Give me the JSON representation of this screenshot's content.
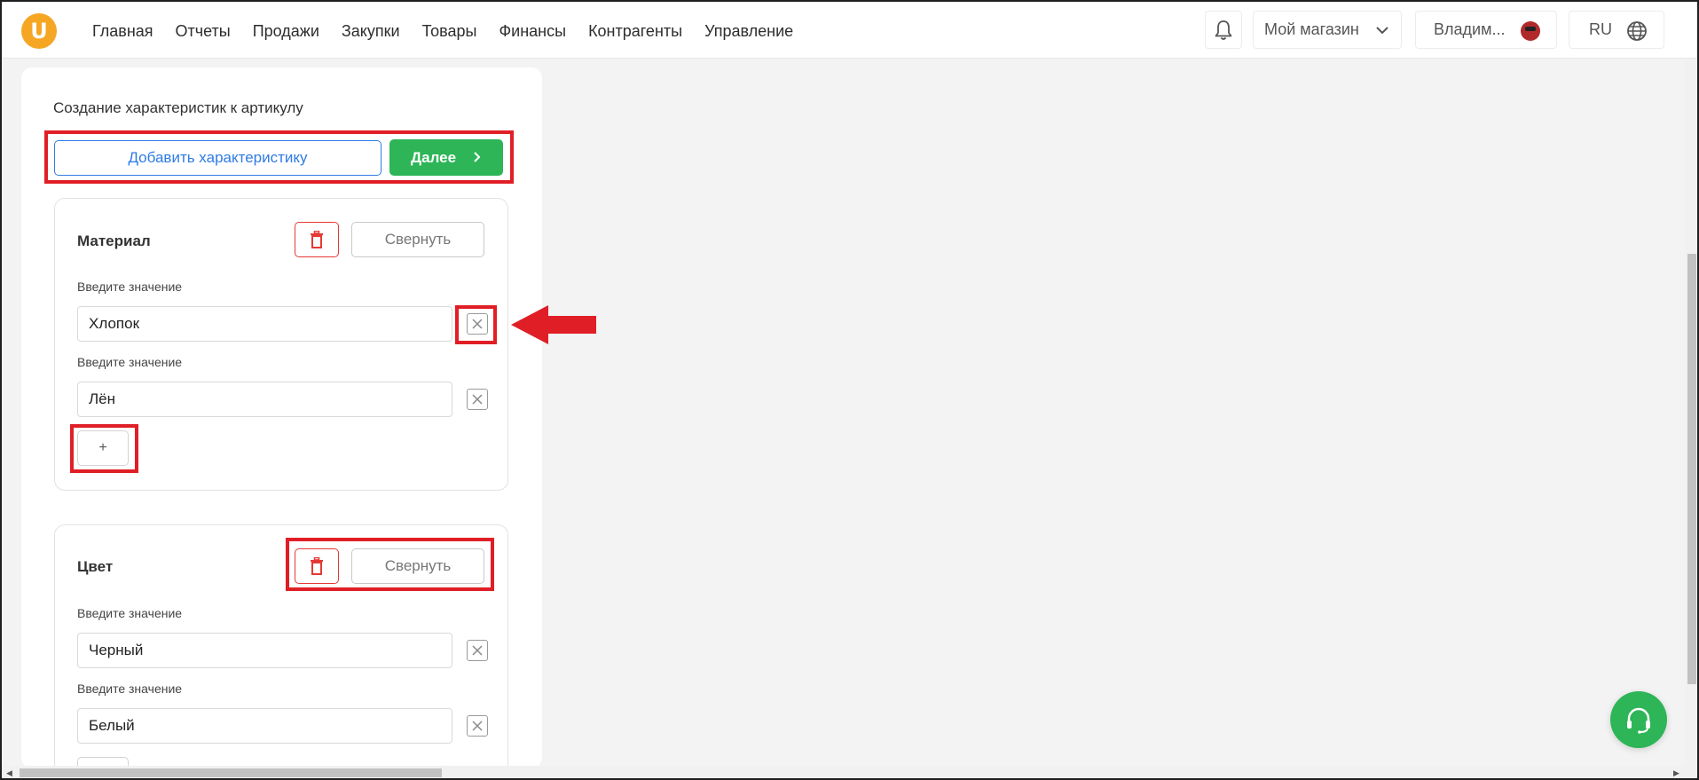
{
  "header": {
    "nav": [
      "Главная",
      "Отчеты",
      "Продажи",
      "Закупки",
      "Товары",
      "Финансы",
      "Контрагенты",
      "Управление"
    ],
    "shop": "Мой магазин",
    "user": "Владим...",
    "lang": "RU"
  },
  "panel": {
    "title": "Создание характеристик к артикулу",
    "add_label": "Добавить характеристику",
    "next_label": "Далее"
  },
  "cards": [
    {
      "title": "Материал",
      "collapse_label": "Свернуть",
      "values": [
        {
          "label": "Введите значение",
          "value": "Хлопок"
        },
        {
          "label": "Введите значение",
          "value": "Лён"
        }
      ],
      "plus_label": "+"
    },
    {
      "title": "Цвет",
      "collapse_label": "Свернуть",
      "values": [
        {
          "label": "Введите значение",
          "value": "Черный"
        },
        {
          "label": "Введите значение",
          "value": "Белый"
        }
      ]
    }
  ],
  "colors": {
    "accent_green": "#2db557",
    "accent_blue": "#2f7be5",
    "danger_red": "#e53935",
    "annotation_red": "#e01e26",
    "logo_orange": "#f5a623"
  },
  "icons": [
    "logo-icon",
    "bell-icon",
    "chevron-down-icon",
    "globe-icon",
    "chevron-right-icon",
    "trash-icon",
    "close-icon",
    "headset-icon"
  ]
}
